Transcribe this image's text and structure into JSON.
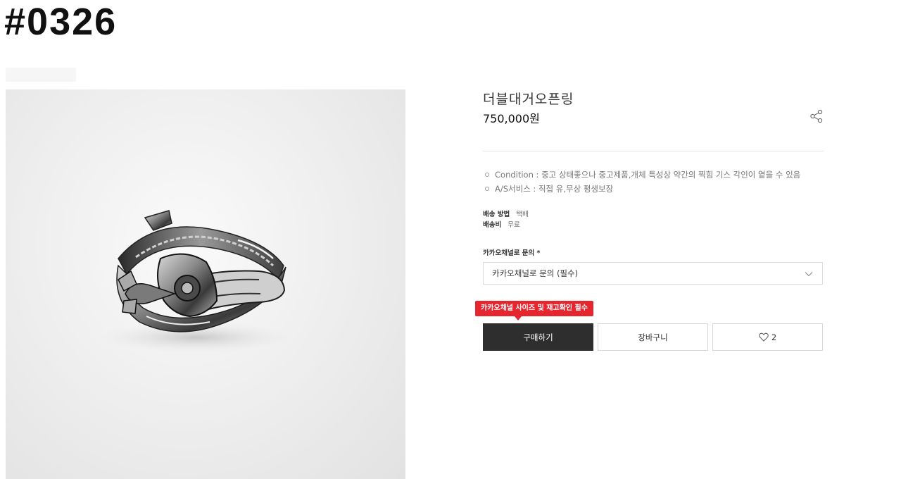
{
  "header": {
    "sku": "#0326"
  },
  "product": {
    "title": "더블대거오픈링",
    "price": "750,000원"
  },
  "details": [
    {
      "text": "Condition : 중고 상태좋으나 중고제품,개체 특성상 약간의 찍힘 기스 각인이 옅을 수 있음"
    },
    {
      "text": "A/S서비스 : 직접 유,무상 평생보장"
    }
  ],
  "shipping": {
    "method_label": "배송 방법",
    "method_value": "택배",
    "fee_label": "배송비",
    "fee_value": "무료"
  },
  "option": {
    "label": "카카오채널로 문의",
    "required_mark": "*",
    "selected": "카카오채널로 문의 (필수)"
  },
  "tooltip": {
    "text": "카카오채널 사이즈 및 재고확인 필수"
  },
  "actions": {
    "buy_label": "구매하기",
    "cart_label": "장바구니",
    "like_count": "2"
  },
  "icons": {
    "share": "share-icon",
    "chevron": "chevron-down-icon",
    "heart": "heart-icon"
  },
  "colors": {
    "buy_button": "#2e2e2e",
    "tooltip": "#e5262f"
  }
}
